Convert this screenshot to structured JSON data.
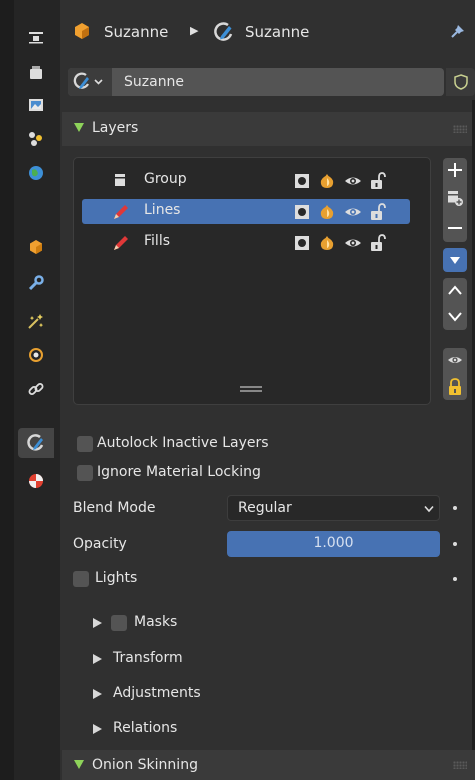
{
  "header": {
    "object_name": "Suzanne",
    "data_name": "Suzanne",
    "object_icon": "object-data-icon",
    "data_icon": "grease-pencil-icon",
    "pin_icon": "pin-icon"
  },
  "datablock": {
    "name": "Suzanne",
    "fake_user_icon": "shield-icon"
  },
  "tabs": [
    {
      "icon": "tool-icon",
      "active": false
    },
    {
      "icon": "render-icon",
      "active": false
    },
    {
      "icon": "output-icon",
      "active": false
    },
    {
      "icon": "view-layer-icon",
      "active": false
    },
    {
      "icon": "scene-icon",
      "active": false
    },
    {
      "icon": "world-icon",
      "active": false
    },
    {
      "icon": "object-icon",
      "active": false
    },
    {
      "icon": "modifier-icon",
      "active": false
    },
    {
      "icon": "shader-fx-icon",
      "active": false
    },
    {
      "icon": "physics-icon",
      "active": false
    },
    {
      "icon": "constraint-icon",
      "active": false
    },
    {
      "icon": "grease-pencil-data-icon",
      "active": true
    },
    {
      "icon": "material-icon",
      "active": false
    }
  ],
  "layers_panel": {
    "title": "Layers",
    "layers": [
      {
        "name": "Group",
        "type": "group",
        "selected": false
      },
      {
        "name": "Lines",
        "type": "layer",
        "selected": true
      },
      {
        "name": "Fills",
        "type": "layer",
        "selected": false
      }
    ],
    "side_buttons": [
      "add-layer-button",
      "add-group-button",
      "remove-layer-button",
      "specials-button",
      "move-up-button",
      "move-down-button",
      "isolate-visibility-button",
      "isolate-lock-button"
    ]
  },
  "options": {
    "autolock_label": "Autolock Inactive Layers",
    "autolock_checked": false,
    "ignore_material_label": "Ignore Material Locking",
    "ignore_material_checked": false,
    "blend_mode_label": "Blend Mode",
    "blend_mode_value": "Regular",
    "opacity_label": "Opacity",
    "opacity_value": "1.000",
    "opacity_fraction": 1.0,
    "lights_label": "Lights",
    "lights_checked": false
  },
  "subpanels": {
    "masks": "Masks",
    "transform": "Transform",
    "adjustments": "Adjustments",
    "relations": "Relations"
  },
  "onion_panel": {
    "title": "Onion Skinning"
  },
  "colors": {
    "selection": "#4772b3",
    "panel_bg": "#3a3a3a",
    "expand_accent": "#8ed35a"
  }
}
